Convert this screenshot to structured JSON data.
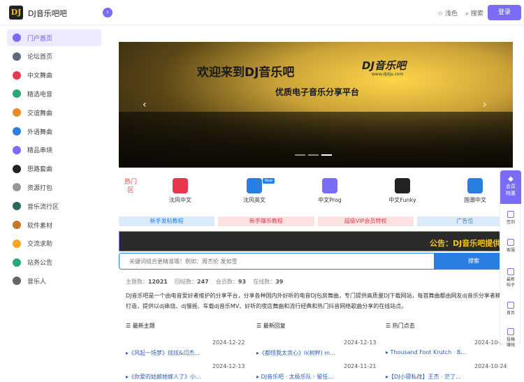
{
  "header": {
    "logo_text": "DJ",
    "site_name": "DJ音乐吧吧",
    "collapse_icon": "‹",
    "theme_toggle": "☆ 浅色",
    "search": "⌕ 搜索",
    "login": "登录"
  },
  "sidebar": {
    "items": [
      {
        "label": "门户首页",
        "icon": "home-icon",
        "color": "#7b6cf6"
      },
      {
        "label": "论坛首页",
        "icon": "chat-icon",
        "color": "#5a6b7b"
      },
      {
        "label": "中文舞曲",
        "icon": "music-note-icon",
        "color": "#e8384f"
      },
      {
        "label": "精选电音",
        "icon": "disc-icon",
        "color": "#2aa876"
      },
      {
        "label": "交谊舞曲",
        "icon": "dance-icon",
        "color": "#e88a2a"
      },
      {
        "label": "外语舞曲",
        "icon": "note-icon",
        "color": "#2a7de1"
      },
      {
        "label": "精品串烧",
        "icon": "mix-icon",
        "color": "#7b6cf6"
      },
      {
        "label": "思路套曲",
        "icon": "vinyl-icon",
        "color": "#222222"
      },
      {
        "label": "资源打包",
        "icon": "package-icon",
        "color": "#999999"
      },
      {
        "label": "音乐流行区",
        "icon": "globe-icon",
        "color": "#2a6a5a"
      },
      {
        "label": "软件素材",
        "icon": "tool-icon",
        "color": "#c8782a"
      },
      {
        "label": "交流求助",
        "icon": "help-icon",
        "color": "#f5a623"
      },
      {
        "label": "站务公告",
        "icon": "megaphone-icon",
        "color": "#2aa876"
      },
      {
        "label": "音乐人",
        "icon": "person-icon",
        "color": "#666666"
      }
    ]
  },
  "banner": {
    "title": "欢迎来到DJ音乐吧",
    "brand": "DJ音乐吧",
    "url": "www.djdja.com",
    "subtitle": "优质电子音乐分享平台",
    "prev": "‹",
    "next": "›"
  },
  "hot": {
    "label": "热门区",
    "items": [
      {
        "label": "沈风中文",
        "color": "#e8384f",
        "new": false
      },
      {
        "label": "沈风英文",
        "color": "#2a7de1",
        "new": true,
        "new_text": "New"
      },
      {
        "label": "中文Prog",
        "color": "#7b6cf6",
        "new": false
      },
      {
        "label": "中文Funky",
        "color": "#222222",
        "new": false
      },
      {
        "label": "国潮中文",
        "color": "#2a7de1",
        "new": false
      }
    ]
  },
  "links": [
    {
      "label": "新手发帖教程",
      "bg": "#dcebfb",
      "color": "#2a7de1"
    },
    {
      "label": "新手赚币教程",
      "bg": "#fde2e2",
      "color": "#e8384f"
    },
    {
      "label": "超级VIP会员特权",
      "bg": "#fde2e2",
      "color": "#e8384f"
    },
    {
      "label": "广告位",
      "bg": "#dcebfb",
      "color": "#2a7de1"
    }
  ],
  "notice": "公告：DJ音乐吧提供",
  "search": {
    "placeholder": "关键词组合更精准哦！例如：周杰伦 发如雪",
    "button": "搜索"
  },
  "stats": {
    "topics_label": "主题数：",
    "topics": "12021",
    "posts_label": "回帖数：",
    "posts": "247",
    "members_label": "会员数：",
    "members": "93",
    "online_label": "在线数：",
    "online": "39"
  },
  "description": "DJ音乐吧是一个由电音爱好者维护的分享平台，分享各种国内外好听的电音DJ包房舞曲，专门提供高质量DJ下载网站，每首舞曲都由网友dj音乐分享者精心打造，提供以dj串烧、dj慢摇、车载dj音乐MV、好听的夜店舞曲和流行经典和热门抖音网络歌曲分享的在线站点。",
  "columns": [
    {
      "header": "☰ 最新主题",
      "posts": [
        {
          "title": "▸《风起一场梦》炫炫&闫杰...",
          "date": "2024-12-22"
        },
        {
          "title": "▸《你爱的姑娘她嫁人了》小...",
          "date": "2024-12-13"
        }
      ]
    },
    {
      "header": "☰ 最新回复",
      "posts": [
        {
          "title": "▸《都怪我太贪心》li(树秤) m...",
          "date": "2024-12-13"
        },
        {
          "title": "▸ DJ音乐吧 · 太极乐队 · 留任...",
          "date": "2024-11-21"
        }
      ]
    },
    {
      "header": "☰ 热门点击",
      "posts": [
        {
          "title": "▸ Thousand Foot Krutch · B...",
          "date": "2024-10-..."
        },
        {
          "title": "▸【DJ小寝私改】王杰 · 茫了...",
          "date": "2024-10-24"
        }
      ]
    }
  ],
  "floatbar": {
    "top": "会员\n特惠",
    "items": [
      "签到",
      "客服",
      "最新\n帖子",
      "首页",
      "投稿\n赚钱"
    ]
  }
}
